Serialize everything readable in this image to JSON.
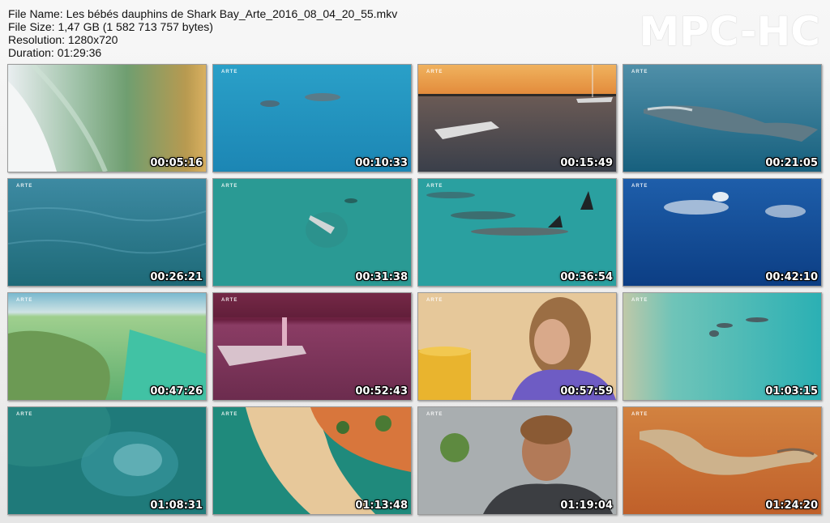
{
  "header": {
    "file_name": "File Name: Les bébés dauphins de Shark Bay_Arte_2016_08_04_20_55.mkv",
    "file_size": "File Size: 1,47 GB (1 582 713 757 bytes)",
    "resolution": "Resolution: 1280x720",
    "duration": "Duration: 01:29:36"
  },
  "logo": "MPC-HC",
  "thumbnails": [
    {
      "time": "00:05:16",
      "brand": ""
    },
    {
      "time": "00:10:33",
      "brand": "ARTE"
    },
    {
      "time": "00:15:49",
      "brand": "ARTE"
    },
    {
      "time": "00:21:05",
      "brand": "ARTE"
    },
    {
      "time": "00:26:21",
      "brand": "ARTE"
    },
    {
      "time": "00:31:38",
      "brand": "ARTE"
    },
    {
      "time": "00:36:54",
      "brand": "ARTE"
    },
    {
      "time": "00:42:10",
      "brand": "ARTE"
    },
    {
      "time": "00:47:26",
      "brand": "ARTE"
    },
    {
      "time": "00:52:43",
      "brand": "ARTE"
    },
    {
      "time": "00:57:59",
      "brand": "ARTE"
    },
    {
      "time": "01:03:15",
      "brand": "ARTE"
    },
    {
      "time": "01:08:31",
      "brand": "ARTE"
    },
    {
      "time": "01:13:48",
      "brand": "ARTE"
    },
    {
      "time": "01:19:04",
      "brand": "ARTE"
    },
    {
      "time": "01:24:20",
      "brand": "ARTE"
    }
  ]
}
